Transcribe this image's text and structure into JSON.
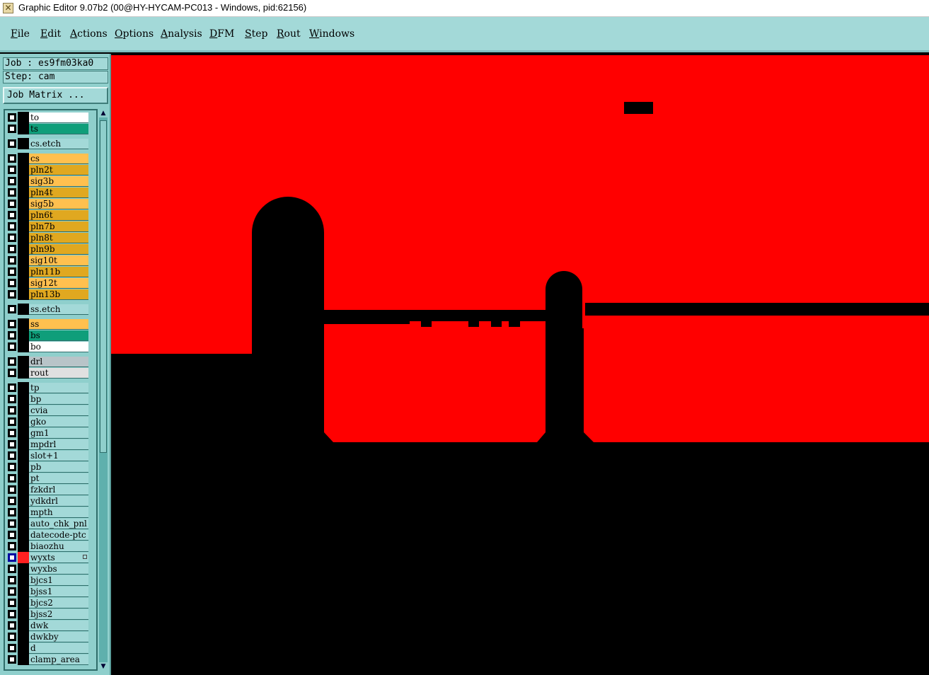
{
  "window": {
    "title": "Graphic Editor 9.07b2 (00@HY-HYCAM-PC013 - Windows, pid:62156)"
  },
  "menu": [
    "File",
    "Edit",
    "Actions",
    "Options",
    "Analysis",
    "DFM",
    "Step",
    "Rout",
    "Windows"
  ],
  "job": {
    "label": "Job : es9fm03ka0"
  },
  "step": {
    "label": "Step: cam"
  },
  "job_matrix": {
    "label": "Job Matrix ..."
  },
  "layers": [
    {
      "name": "to",
      "style": "white"
    },
    {
      "name": "ts",
      "style": "green"
    },
    {
      "name": "cs.etch",
      "style": "teal"
    },
    {
      "name": "cs",
      "style": "orange"
    },
    {
      "name": "pln2t",
      "style": "dorange"
    },
    {
      "name": "sig3b",
      "style": "orange"
    },
    {
      "name": "pln4t",
      "style": "dorange"
    },
    {
      "name": "sig5b",
      "style": "orange"
    },
    {
      "name": "pln6t",
      "style": "dorange"
    },
    {
      "name": "pln7b",
      "style": "dorange"
    },
    {
      "name": "pln8t",
      "style": "dorange"
    },
    {
      "name": "pln9b",
      "style": "dorange"
    },
    {
      "name": "sig10t",
      "style": "orange"
    },
    {
      "name": "pln11b",
      "style": "dorange"
    },
    {
      "name": "sig12t",
      "style": "orange"
    },
    {
      "name": "pln13b",
      "style": "dorange"
    },
    {
      "name": "ss.etch",
      "style": "teal"
    },
    {
      "name": "ss",
      "style": "orange"
    },
    {
      "name": "bs",
      "style": "green"
    },
    {
      "name": "bo",
      "style": "white"
    },
    {
      "name": "drl",
      "style": "grey"
    },
    {
      "name": "rout",
      "style": "lgrey"
    },
    {
      "name": "tp",
      "style": "teal"
    },
    {
      "name": "bp",
      "style": "teal"
    },
    {
      "name": "cvia",
      "style": "teal"
    },
    {
      "name": "gko",
      "style": "teal"
    },
    {
      "name": "gm1",
      "style": "teal"
    },
    {
      "name": "mpdrl",
      "style": "teal"
    },
    {
      "name": "slot+1",
      "style": "teal"
    },
    {
      "name": "pb",
      "style": "teal"
    },
    {
      "name": "pt",
      "style": "teal"
    },
    {
      "name": "fzkdrl",
      "style": "teal"
    },
    {
      "name": "ydkdrl",
      "style": "teal"
    },
    {
      "name": "mpth",
      "style": "teal"
    },
    {
      "name": "auto_chk_pnl",
      "style": "teal"
    },
    {
      "name": "datecode-ptc",
      "style": "teal"
    },
    {
      "name": "biaozhu",
      "style": "teal"
    },
    {
      "name": "wyxts",
      "style": "teal",
      "selected": true
    },
    {
      "name": "wyxbs",
      "style": "teal"
    },
    {
      "name": "bjcs1",
      "style": "teal"
    },
    {
      "name": "bjss1",
      "style": "teal"
    },
    {
      "name": "bjcs2",
      "style": "teal"
    },
    {
      "name": "bjss2",
      "style": "teal"
    },
    {
      "name": "dwk",
      "style": "teal"
    },
    {
      "name": "dwkby",
      "style": "teal"
    },
    {
      "name": "d",
      "style": "teal"
    },
    {
      "name": "clamp_area",
      "style": "teal"
    }
  ],
  "colors": {
    "copper": "#ff0000",
    "background": "#000000",
    "panel": "#a3d9d8"
  }
}
